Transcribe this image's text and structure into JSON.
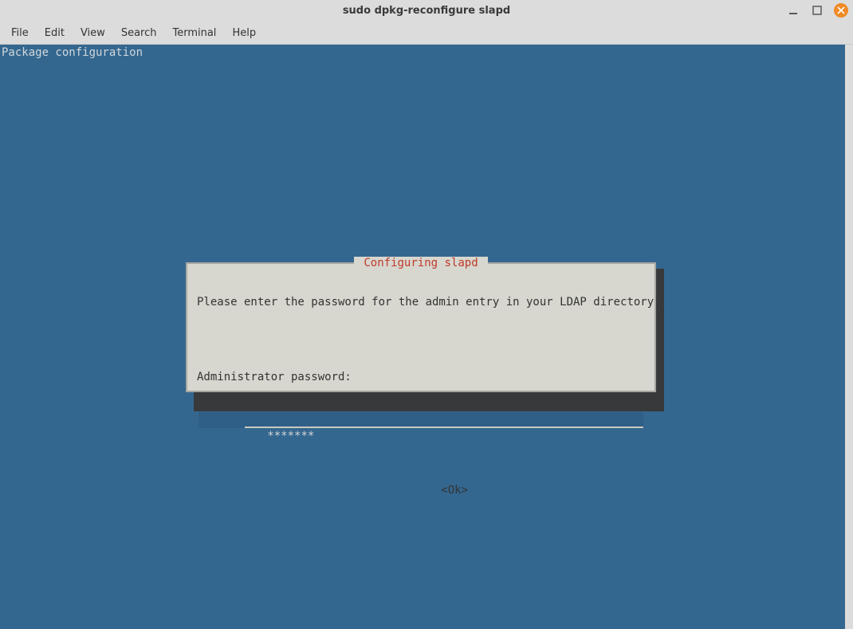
{
  "window": {
    "title": "sudo dpkg-reconfigure slapd"
  },
  "menu": {
    "file": "File",
    "edit": "Edit",
    "view": "View",
    "search": "Search",
    "terminal": "Terminal",
    "help": "Help"
  },
  "terminal": {
    "header_line": "Package configuration"
  },
  "dialog": {
    "title": " Configuring slapd ",
    "prompt": "Please enter the password for the admin entry in your LDAP directory.",
    "label": "Administrator password:",
    "password_masked": "*******",
    "ok": "<Ok>"
  }
}
